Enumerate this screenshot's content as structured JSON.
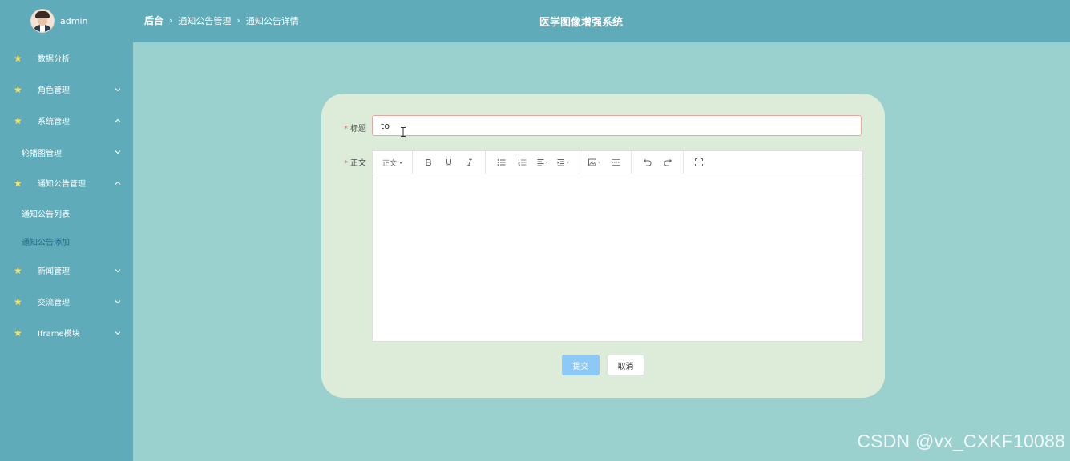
{
  "header": {
    "username": "admin",
    "breadcrumb": [
      "后台",
      "通知公告管理",
      "通知公告详情"
    ],
    "system_title": "医学图像增强系统",
    "colors": {
      "bar": "#5fabb9",
      "background": "#9ad0cd"
    }
  },
  "sidebar": {
    "items": [
      {
        "label": "数据分析",
        "icon": "star-icon",
        "expandable": false
      },
      {
        "label": "角色管理",
        "icon": "star-icon",
        "expandable": true,
        "expanded": false
      },
      {
        "label": "系统管理",
        "icon": "star-icon",
        "expandable": true,
        "expanded": true
      },
      {
        "label": "轮播图管理",
        "sub": true,
        "expandable": true,
        "expanded": false
      },
      {
        "label": "通知公告管理",
        "icon": "star-icon",
        "expandable": true,
        "expanded": true
      },
      {
        "label": "通知公告列表",
        "sub": true
      },
      {
        "label": "通知公告添加",
        "sub": true,
        "active": true
      },
      {
        "label": "新闻管理",
        "icon": "star-icon",
        "expandable": true,
        "expanded": false
      },
      {
        "label": "交流管理",
        "icon": "star-icon",
        "expandable": true,
        "expanded": false
      },
      {
        "label": "Iframe模块",
        "icon": "star-icon",
        "expandable": true,
        "expanded": false
      }
    ]
  },
  "form": {
    "title_label": "标题",
    "title_value": "to",
    "body_label": "正文",
    "required_mark": "*",
    "editor_toolbar": {
      "heading_select": "正文",
      "buttons": [
        "bold-icon",
        "underline-icon",
        "italic-icon",
        "bullet-list-icon",
        "ordered-list-icon",
        "align-icon",
        "indent-icon",
        "image-icon",
        "divider-icon",
        "undo-icon",
        "redo-icon",
        "fullscreen-icon"
      ]
    },
    "submit_label": "提交",
    "cancel_label": "取消",
    "colors": {
      "card": "#dcecd9",
      "submit": "#8cc9f6",
      "required": "#f56c6c"
    }
  },
  "watermark": "CSDN @vx_CXKF10088"
}
